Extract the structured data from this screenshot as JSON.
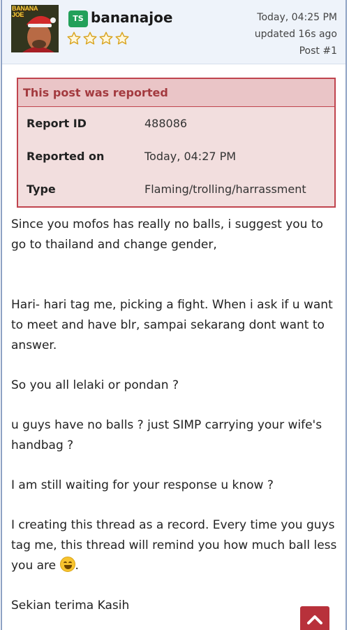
{
  "post": {
    "avatar": {
      "text": "BANANA JOE",
      "icon": "avatar-santa-hat"
    },
    "user_badge": "TS",
    "username": "bananajoe",
    "rating": {
      "stars_total": 4,
      "stars_filled": 0,
      "icon": "star-outline-icon"
    },
    "timestamp": "Today, 04:25 PM",
    "updated": "updated 16s ago",
    "post_number": "Post #1"
  },
  "report": {
    "title": "This post was reported",
    "rows": [
      {
        "label": "Report ID",
        "value": "488086"
      },
      {
        "label": "Reported on",
        "value": "Today, 04:27 PM"
      },
      {
        "label": "Type",
        "value": "Flaming/trolling/harrassment"
      }
    ]
  },
  "message": {
    "paragraphs": [
      "Since you mofos has really no balls, i suggest you to go to thailand and change gender,",
      "Hari- hari tag me, picking a fight. When i ask if u want to meet and have blr, sampai sekarang dont want to answer.",
      "So you all lelaki or pondan ?",
      "u guys have no balls ? just SIMP carrying your wife's handbag ?",
      "I am still waiting for your response u know ?",
      "I creating this thread as a record. Every time you guys tag me, this thread will remind you how much ball less you are",
      "Sekian terima Kasih"
    ],
    "emoji_after_p6": "grinning-face-emoji",
    "p6_trailing": "."
  },
  "scroll_top": {
    "icon": "chevron-up-icon"
  },
  "colors": {
    "header_bg": "#eef3fa",
    "badge_green": "#22a05a",
    "report_border": "#c0444e",
    "report_title_bg": "#eac5c7",
    "report_body_bg": "#f2dede",
    "report_title_text": "#a33a3f",
    "scroll_btn": "#b8313b",
    "star_outline": "#d9a521"
  }
}
